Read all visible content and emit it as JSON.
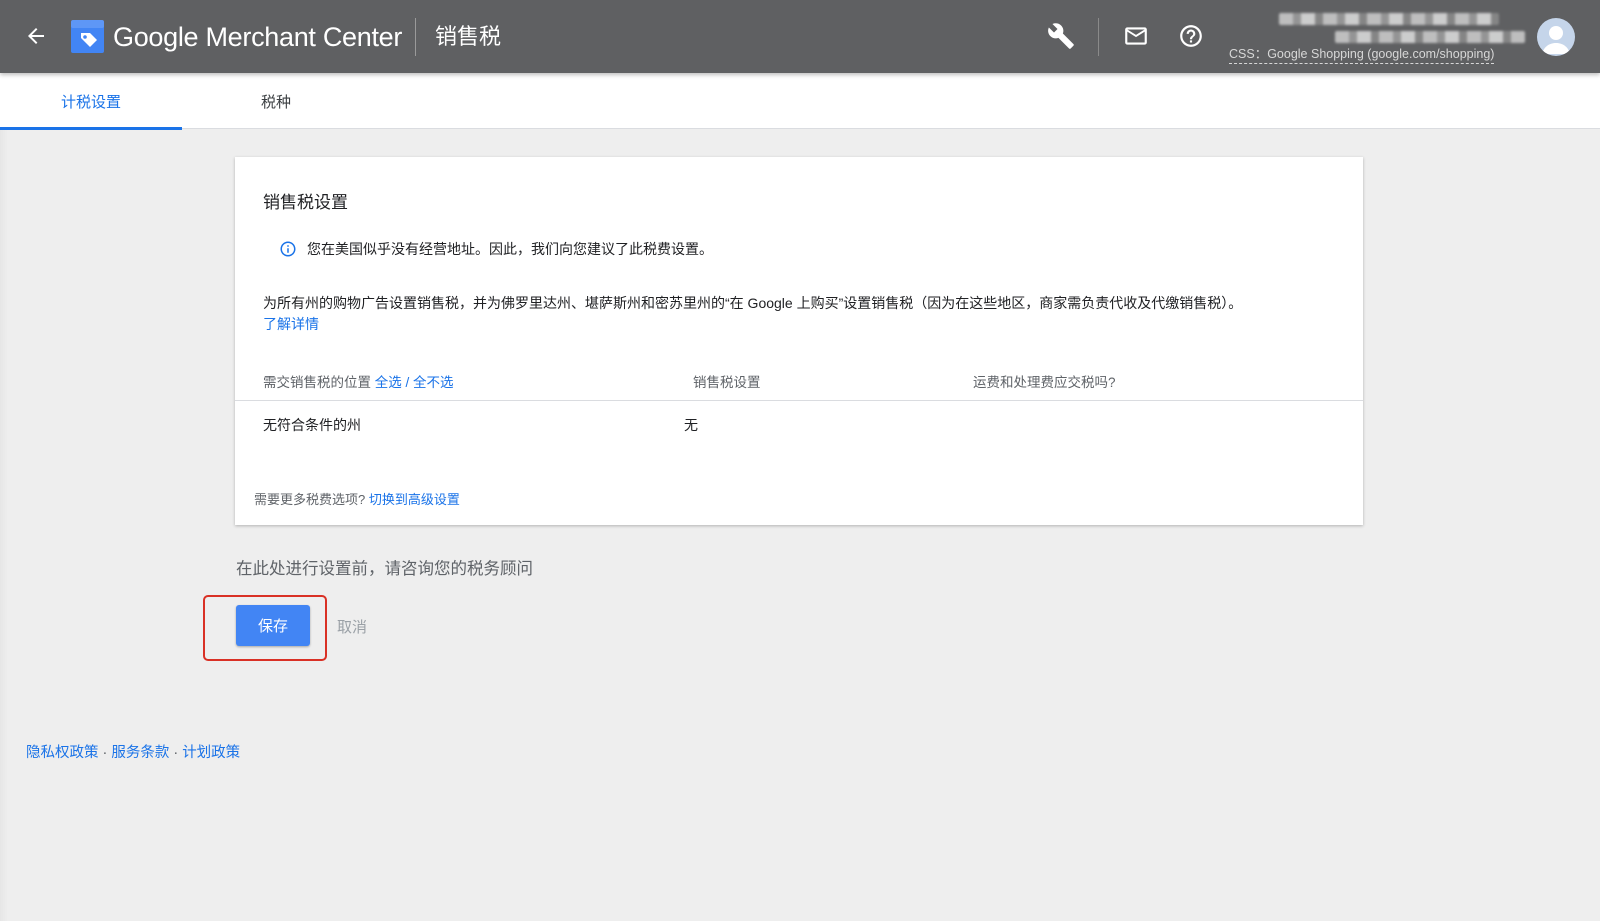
{
  "header": {
    "brand": "Google Merchant Center",
    "page_title": "销售税",
    "css_label": "CSS：Google Shopping (google.com/shopping)"
  },
  "tabs": [
    {
      "label": "计税设置",
      "active": true
    },
    {
      "label": "税种",
      "active": false
    }
  ],
  "card": {
    "title": "销售税设置",
    "info": "您在美国似乎没有经营地址。因此，我们向您建议了此税费设置。",
    "description": "为所有州的购物广告设置销售税，并为佛罗里达州、堪萨斯州和密苏里州的“在 Google 上购买”设置销售税（因为在这些地区，商家需负责代收及代缴销售税）。",
    "learn_more": "了解详情",
    "table": {
      "col1_label": "需交销售税的位置",
      "select_all": "全选",
      "separator": " / ",
      "select_none": "全不选",
      "col2_label": "销售税设置",
      "col3_label": "运费和处理费应交税吗?",
      "row": {
        "location": "无符合条件的州",
        "setting": "无"
      }
    },
    "more_options": "需要更多税费选项?",
    "advanced_link": "切换到高级设置"
  },
  "advice": "在此处进行设置前，请咨询您的税务顾问",
  "buttons": {
    "save": "保存",
    "cancel": "取消"
  },
  "footer": {
    "privacy": "隐私权政策",
    "terms": "服务条款",
    "program": "计划政策",
    "sep": "·"
  },
  "colors": {
    "appbar": "#5f6062",
    "accent": "#1a73e8",
    "primary_button": "#4285f4",
    "highlight_box": "#d93025"
  }
}
